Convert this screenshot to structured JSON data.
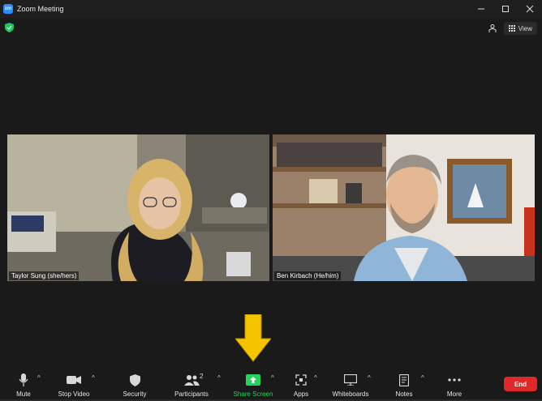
{
  "window": {
    "title": "Zoom Meeting",
    "app_logo": "zm",
    "controls": [
      "minimize",
      "maximize",
      "close"
    ]
  },
  "meeting": {
    "security_shield_color": "#23c55e",
    "view_label": "View",
    "participants_tiles": [
      {
        "name": "Taylor Sung (she/hers)"
      },
      {
        "name": "Ben Kirbach (He/him)"
      }
    ]
  },
  "toolbar": {
    "mute_label": "Mute",
    "stop_video_label": "Stop Video",
    "security_label": "Security",
    "participants_label": "Participants",
    "participants_count": "2",
    "share_screen_label": "Share Screen",
    "apps_label": "Apps",
    "whiteboards_label": "Whiteboards",
    "notes_label": "Notes",
    "more_label": "More",
    "end_label": "End"
  },
  "colors": {
    "share_green": "#24d35a",
    "end_red": "#e02828",
    "arrow_yellow": "#f5c400"
  }
}
